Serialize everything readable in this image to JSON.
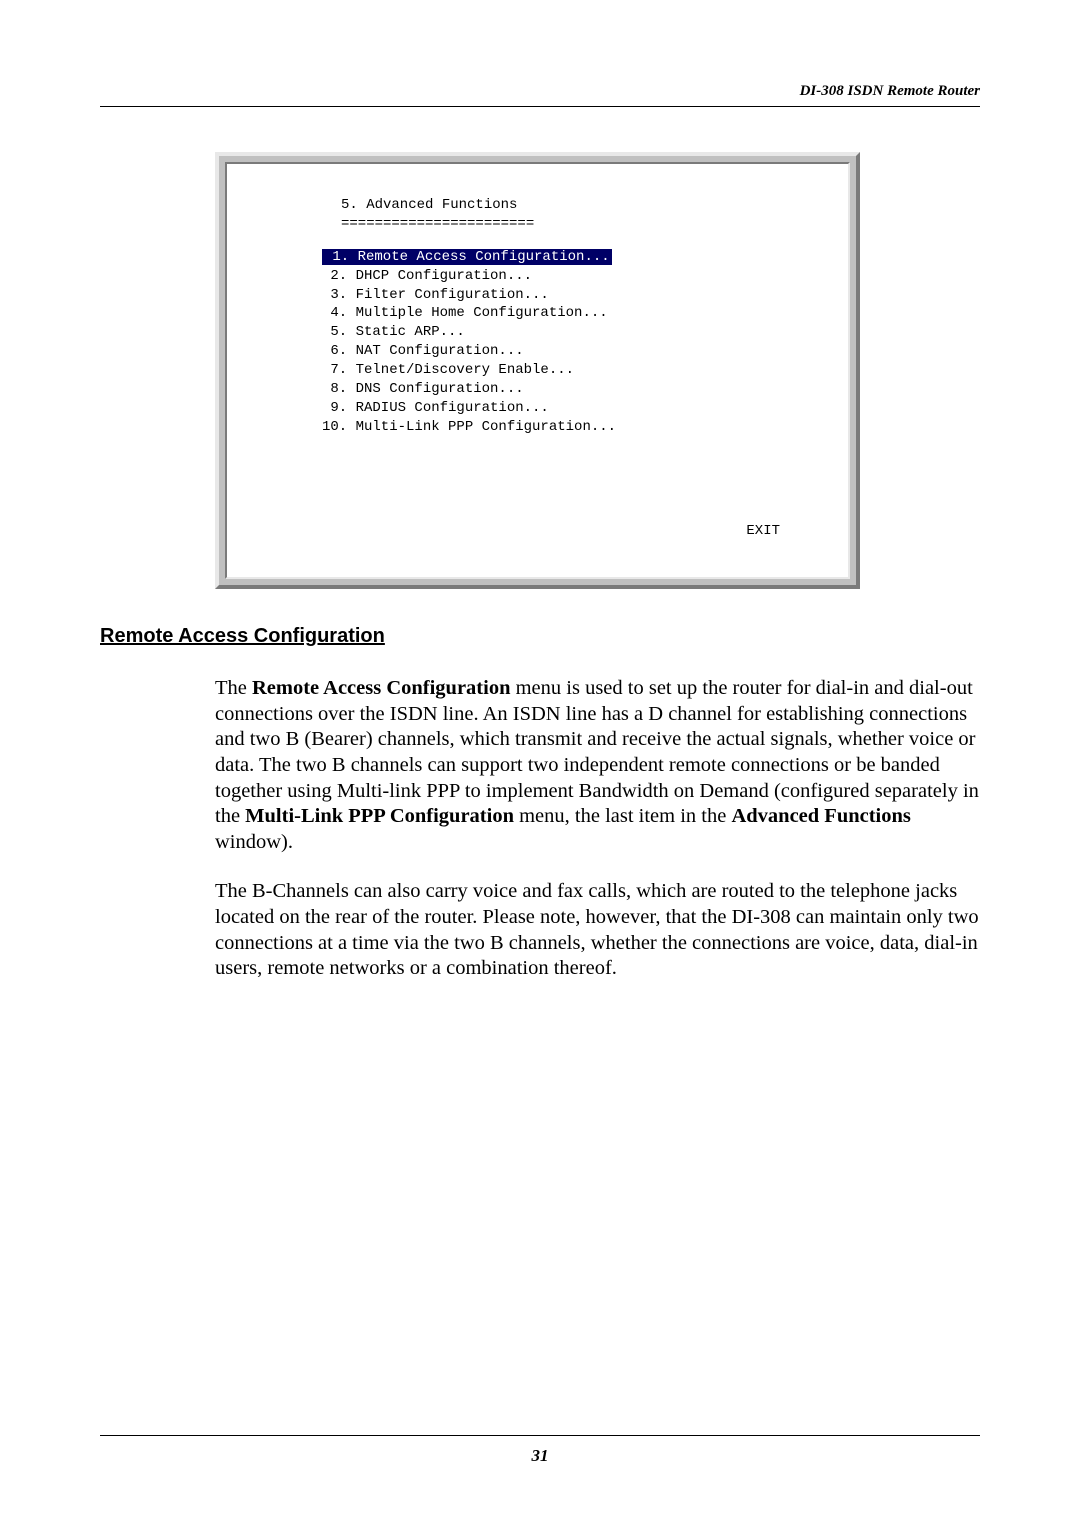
{
  "header": {
    "text": "DI-308 ISDN Remote Router"
  },
  "terminal": {
    "title": "5. Advanced Functions",
    "separator": "=======================",
    "menu": [
      {
        "num": " 1.",
        "label": "Remote Access Configuration...",
        "selected": true
      },
      {
        "num": " 2.",
        "label": "DHCP Configuration...",
        "selected": false
      },
      {
        "num": " 3.",
        "label": "Filter Configuration...",
        "selected": false
      },
      {
        "num": " 4.",
        "label": "Multiple Home Configuration...",
        "selected": false
      },
      {
        "num": " 5.",
        "label": "Static ARP...",
        "selected": false
      },
      {
        "num": " 6.",
        "label": "NAT Configuration...",
        "selected": false
      },
      {
        "num": " 7.",
        "label": "Telnet/Discovery Enable...",
        "selected": false
      },
      {
        "num": " 8.",
        "label": "DNS Configuration...",
        "selected": false
      },
      {
        "num": " 9.",
        "label": "RADIUS Configuration...",
        "selected": false
      },
      {
        "num": "10.",
        "label": "Multi-Link PPP Configuration...",
        "selected": false
      }
    ],
    "exit": "EXIT"
  },
  "section": {
    "heading": "Remote Access Configuration"
  },
  "para1": {
    "t1": "The ",
    "b1": "Remote Access Configuration",
    "t2": " menu is used to set up the router for dial-in and dial-out connections over the ISDN line. An ISDN line has a D channel for establishing connections and two B (Bearer) channels, which transmit and receive the actual signals, whether voice or data. The two B channels can support two independent remote connections or be banded together using Multi-link PPP to implement Bandwidth on Demand (configured separately in the ",
    "b2": "Multi-Link PPP Configuration",
    "t3": " menu, the last item in the ",
    "b3": "Advanced Functions",
    "t4": " window)."
  },
  "para2": {
    "text": "The B-Channels can also carry voice and fax calls, which are routed to the telephone jacks located on the rear of the router. Please note, however, that the DI-308 can maintain only two connections at a time via the two B channels, whether the connections are voice, data, dial-in users, remote networks or a combination thereof."
  },
  "footer": {
    "page": "31"
  }
}
